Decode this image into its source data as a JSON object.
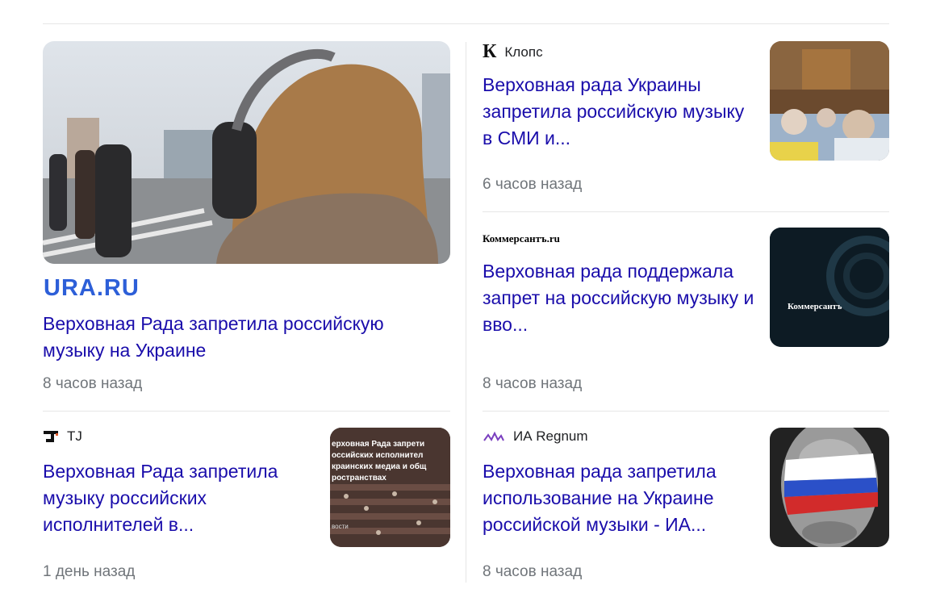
{
  "cards": [
    {
      "source": "URA.RU",
      "headline": "Верховная Рада запретила российскую музыку на Украине",
      "time": "8 часов назад"
    },
    {
      "source": "Клопс",
      "source_logo": "К",
      "headline": "Верховная рада Украины запретила российскую музыку в СМИ и...",
      "time": "6 часов назад"
    },
    {
      "source": "Коммерсантъ.ru",
      "thumb_text": "Коммерсантъ",
      "headline": "Верховная рада поддержала запрет на российскую музыку и вво...",
      "time": "8 часов назад"
    },
    {
      "source": "TJ",
      "source_logo": "J",
      "thumb_lines": [
        "ерховная Рада запрети",
        "оссийских исполнител",
        "краинских медиа и общ",
        "ространствах",
        "вости"
      ],
      "headline": "Верховная Рада запретила музыку российских исполнителей в...",
      "time": "1 день назад"
    },
    {
      "source": "ИА Regnum",
      "headline": "Верховная рада запретила использование на Украине российской музыки - ИА...",
      "time": "8 часов назад"
    }
  ],
  "colors": {
    "headline": "#1a0dab",
    "time": "#70757a",
    "ura_blue": "#2d5fd8"
  }
}
